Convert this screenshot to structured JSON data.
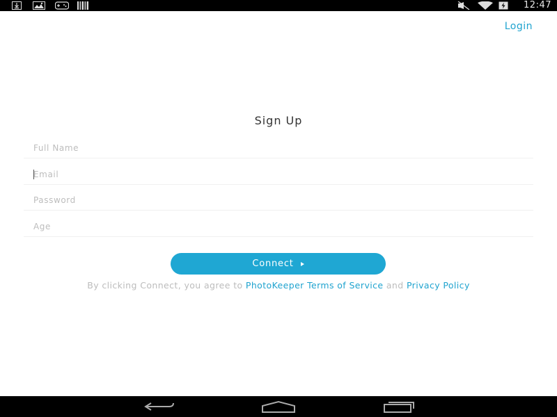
{
  "status_bar": {
    "time": "12:47",
    "icons": [
      "download-icon",
      "image-icon",
      "gamepad-icon",
      "barcode-icon",
      "mute-icon",
      "wifi-icon",
      "battery-icon"
    ]
  },
  "header": {
    "login_label": "Login"
  },
  "form": {
    "title": "Sign Up",
    "fields": [
      {
        "placeholder": "Full Name",
        "value": ""
      },
      {
        "placeholder": "Email",
        "value": ""
      },
      {
        "placeholder": "Password",
        "value": ""
      },
      {
        "placeholder": "Age",
        "value": ""
      }
    ],
    "connect_label": "Connect",
    "terms": {
      "prefix": "By clicking Connect, you agree to ",
      "terms_link": "PhotoKeeper Terms of Service",
      "middle": " and ",
      "privacy_link": "Privacy Policy"
    }
  },
  "nav_bar": {
    "buttons": [
      "back-icon",
      "home-icon",
      "recents-icon"
    ]
  },
  "colors": {
    "accent": "#1fa7d3",
    "placeholder": "#bdbdbd",
    "status_bar": "#000000"
  }
}
